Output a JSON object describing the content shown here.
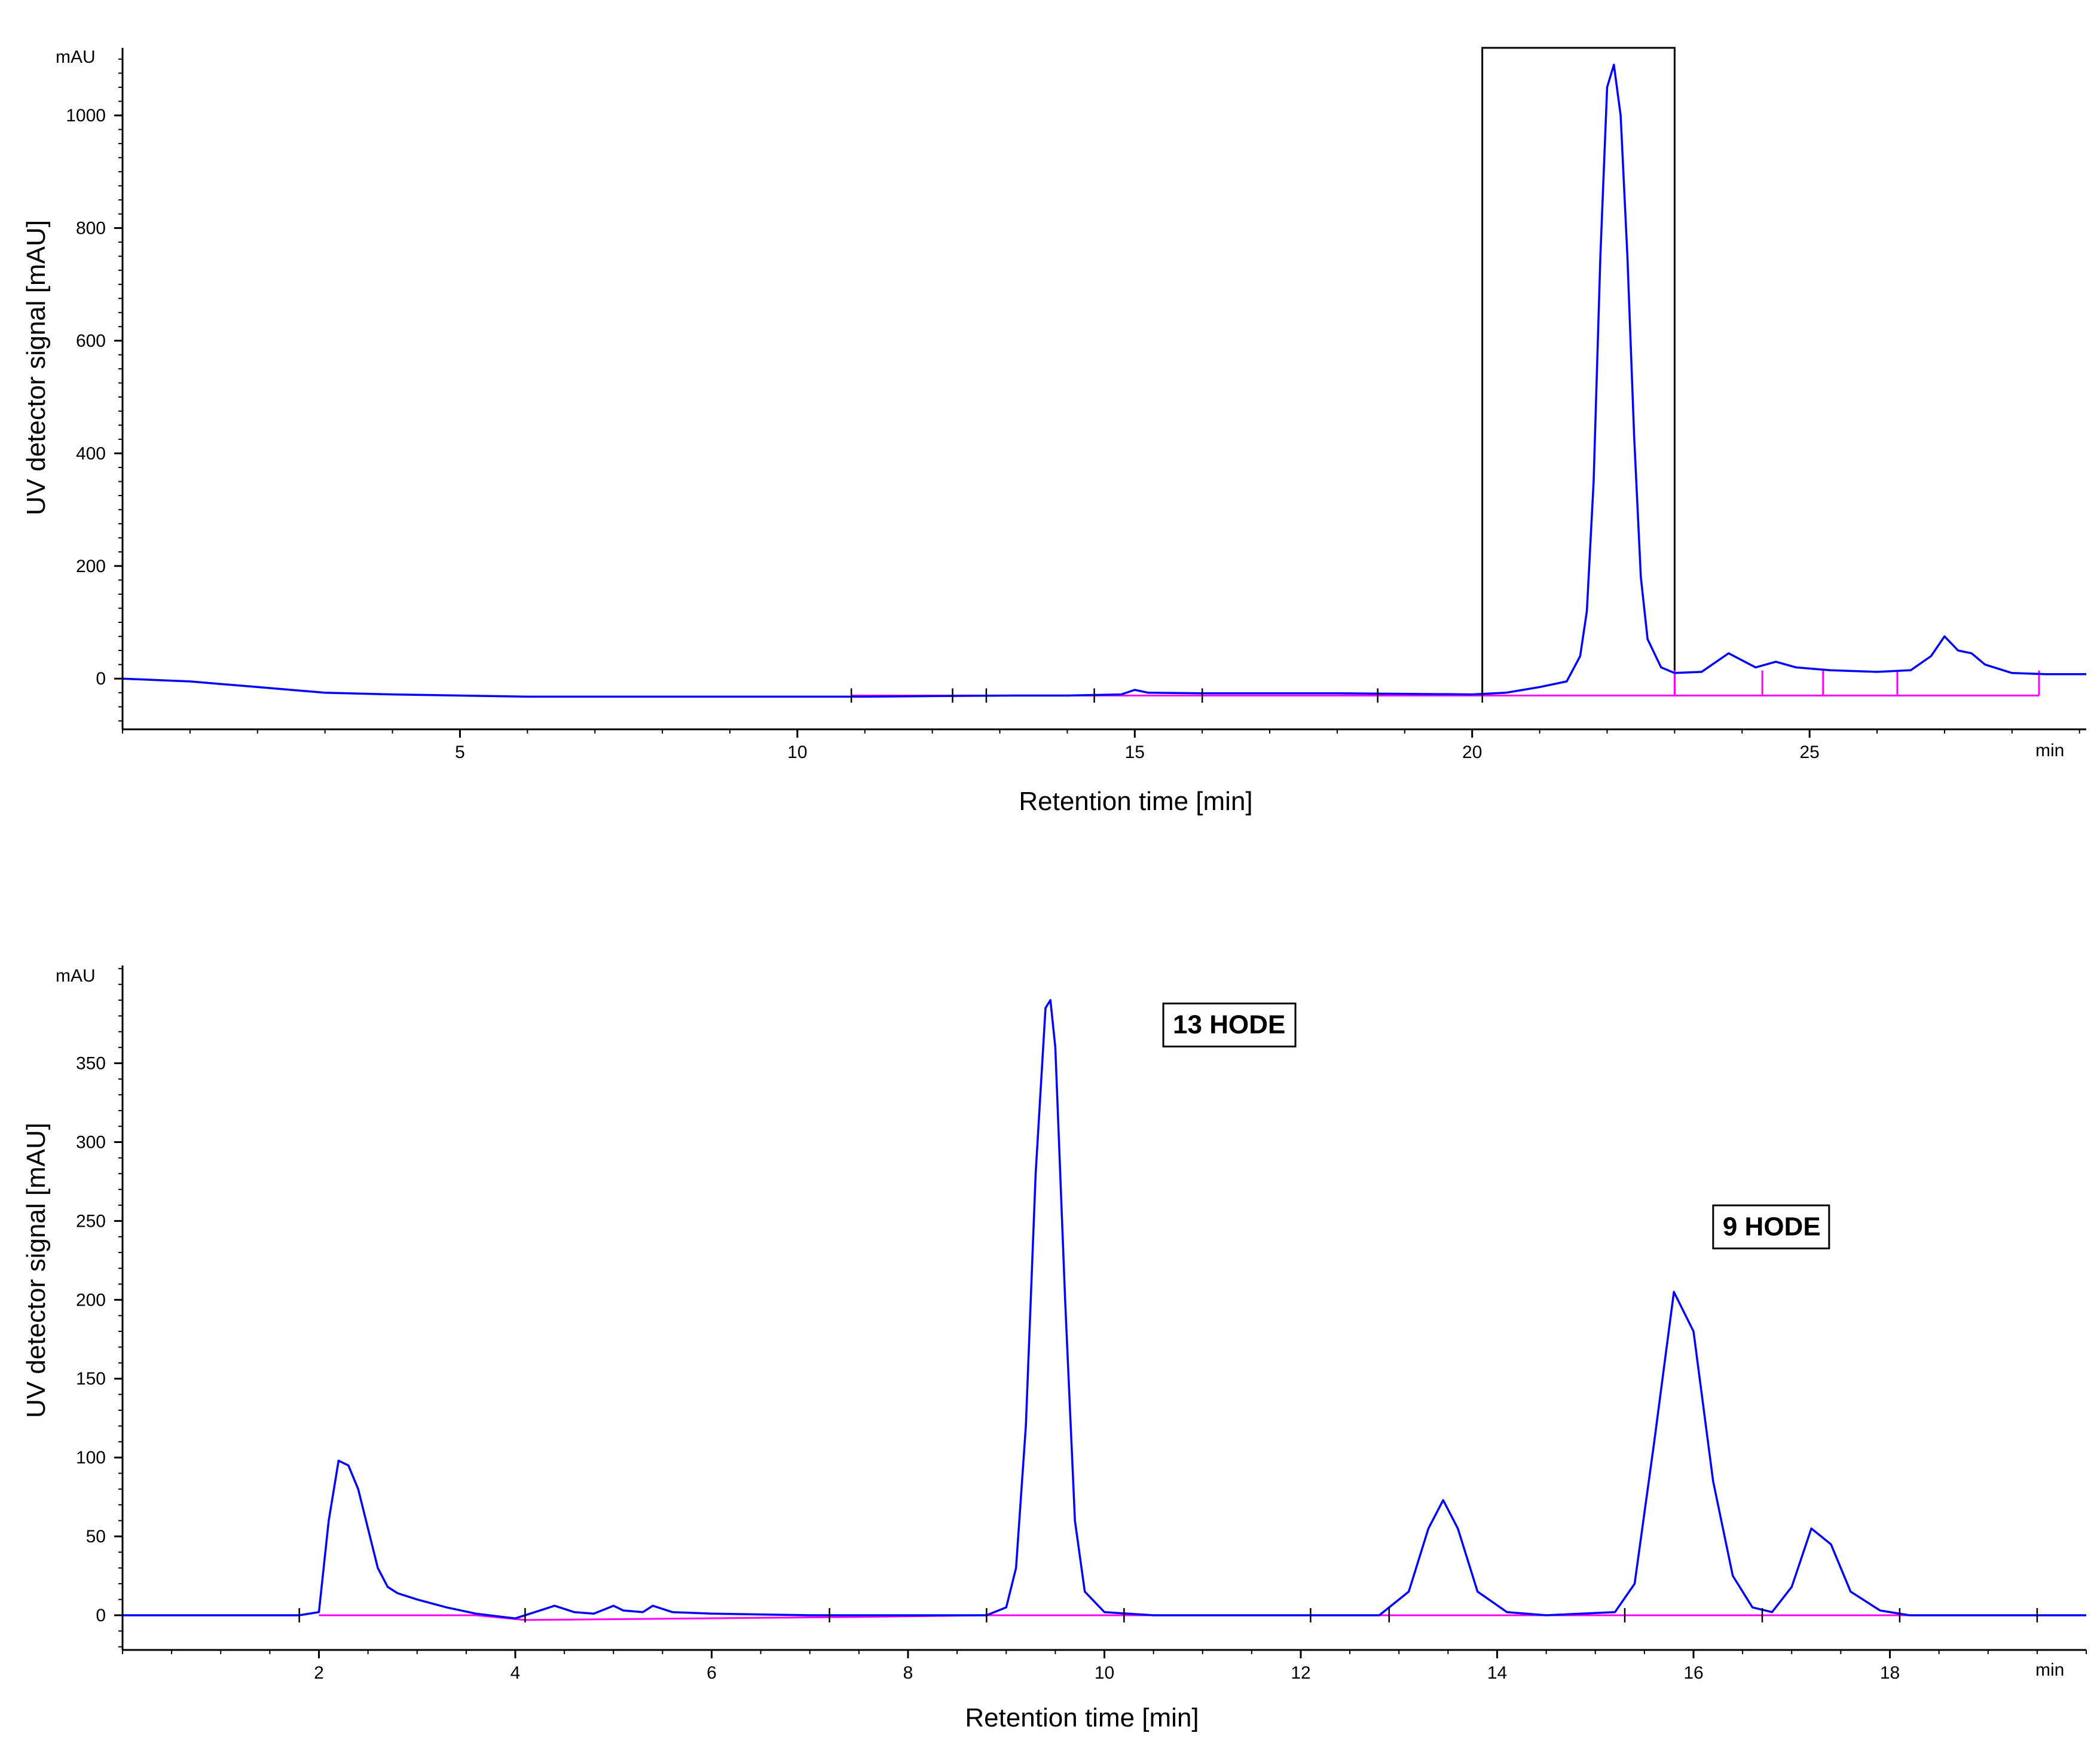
{
  "chart_data": [
    {
      "type": "line",
      "ylabel": "UV detector signal [mAU]",
      "xlabel": "Retention time [min]",
      "y_unit_label": "mAU",
      "x_unit_label": "min",
      "xlim": [
        0,
        29.1
      ],
      "ylim": [
        -90,
        1120
      ],
      "x_ticks": [
        "5",
        "10",
        "15",
        "20",
        "25"
      ],
      "y_ticks": [
        "0",
        "200",
        "400",
        "600",
        "800",
        "1000"
      ],
      "colors": {
        "signal": "#0000ff",
        "baseline": "#ff00ff",
        "axes": "#000000"
      },
      "highlight_box": {
        "x_start": 20.15,
        "x_end": 23.0,
        "y_top": 1120
      },
      "series": [
        {
          "role": "signal",
          "x": [
            0,
            1,
            2,
            3,
            4,
            5,
            6,
            8,
            10,
            11,
            12,
            13.2,
            14,
            14.8,
            15.0,
            15.2,
            16,
            18,
            20,
            20.5,
            21.0,
            21.4,
            21.6,
            21.7,
            21.8,
            21.9,
            22.0,
            22.1,
            22.2,
            22.3,
            22.4,
            22.5,
            22.6,
            22.8,
            23.0,
            23.4,
            23.8,
            24.2,
            24.5,
            24.8,
            25.3,
            26.0,
            26.5,
            26.8,
            27.0,
            27.2,
            27.4,
            27.6,
            28.0,
            28.5,
            29.1
          ],
          "y": [
            0,
            -5,
            -15,
            -25,
            -28,
            -30,
            -32,
            -32,
            -32,
            -32,
            -31,
            -30,
            -30,
            -28,
            -20,
            -25,
            -26,
            -26,
            -28,
            -25,
            -15,
            -5,
            40,
            120,
            350,
            750,
            1050,
            1090,
            1000,
            750,
            430,
            180,
            70,
            20,
            10,
            12,
            45,
            20,
            30,
            20,
            15,
            12,
            15,
            40,
            75,
            50,
            45,
            25,
            10,
            8,
            8
          ]
        },
        {
          "role": "baseline",
          "x": [
            10.8,
            28.4
          ],
          "y": [
            -30,
            -30
          ]
        }
      ],
      "baseline_markers": [
        23.0,
        24.3,
        25.2,
        26.3,
        28.4
      ],
      "integration_ticks": [
        10.8,
        12.3,
        12.8,
        14.4,
        16.0,
        18.6,
        20.15
      ]
    },
    {
      "type": "line",
      "ylabel": "UV detector signal [mAU]",
      "xlabel": "Retention time [min]",
      "y_unit_label": "mAU",
      "x_unit_label": "min",
      "xlim": [
        0,
        20
      ],
      "ylim": [
        -22,
        412
      ],
      "x_ticks": [
        "2",
        "4",
        "6",
        "8",
        "10",
        "12",
        "14",
        "16",
        "18"
      ],
      "y_ticks": [
        "0",
        "50",
        "100",
        "150",
        "200",
        "250",
        "300",
        "350"
      ],
      "colors": {
        "signal": "#0000ff",
        "baseline": "#ff00ff",
        "axes": "#000000"
      },
      "series": [
        {
          "role": "signal",
          "x": [
            0,
            1.8,
            2.0,
            2.1,
            2.2,
            2.3,
            2.4,
            2.5,
            2.6,
            2.7,
            2.8,
            3.0,
            3.3,
            3.6,
            4.0,
            4.3,
            4.4,
            4.6,
            4.8,
            5.0,
            5.1,
            5.3,
            5.4,
            5.6,
            6.0,
            7.0,
            7.6,
            8.0,
            8.8,
            9.0,
            9.1,
            9.2,
            9.3,
            9.4,
            9.45,
            9.5,
            9.6,
            9.7,
            9.8,
            10.0,
            10.5,
            11,
            12,
            12.8,
            13.1,
            13.3,
            13.45,
            13.6,
            13.8,
            14.1,
            14.5,
            15.2,
            15.4,
            15.6,
            15.8,
            16.0,
            16.2,
            16.4,
            16.6,
            16.8,
            17.0,
            17.2,
            17.4,
            17.6,
            17.9,
            18.2,
            19,
            20
          ],
          "y": [
            0,
            0,
            2,
            60,
            98,
            95,
            80,
            55,
            30,
            18,
            14,
            10,
            5,
            1,
            -2,
            4,
            6,
            2,
            1,
            6,
            3,
            2,
            6,
            2,
            1,
            0,
            0,
            0,
            0,
            5,
            30,
            120,
            280,
            385,
            390,
            360,
            200,
            60,
            15,
            2,
            0,
            0,
            0,
            0,
            15,
            55,
            73,
            55,
            15,
            2,
            0,
            2,
            20,
            110,
            205,
            180,
            85,
            25,
            5,
            2,
            18,
            55,
            45,
            15,
            3,
            0,
            0,
            0
          ]
        },
        {
          "role": "baseline",
          "x": [
            2.0,
            3.6,
            4.1,
            7.6,
            8.8,
            18.6
          ],
          "y": [
            0,
            0,
            -3,
            -1,
            0,
            0
          ]
        }
      ],
      "annotations": [
        {
          "text": "13 HODE",
          "x": 10.6,
          "y": 375
        },
        {
          "text": "9 HODE",
          "x": 16.2,
          "y": 247
        }
      ],
      "integration_ticks": [
        1.8,
        4.1,
        7.2,
        8.8,
        10.2,
        12.1,
        12.9,
        15.3,
        16.7,
        18.1,
        19.5
      ]
    }
  ]
}
